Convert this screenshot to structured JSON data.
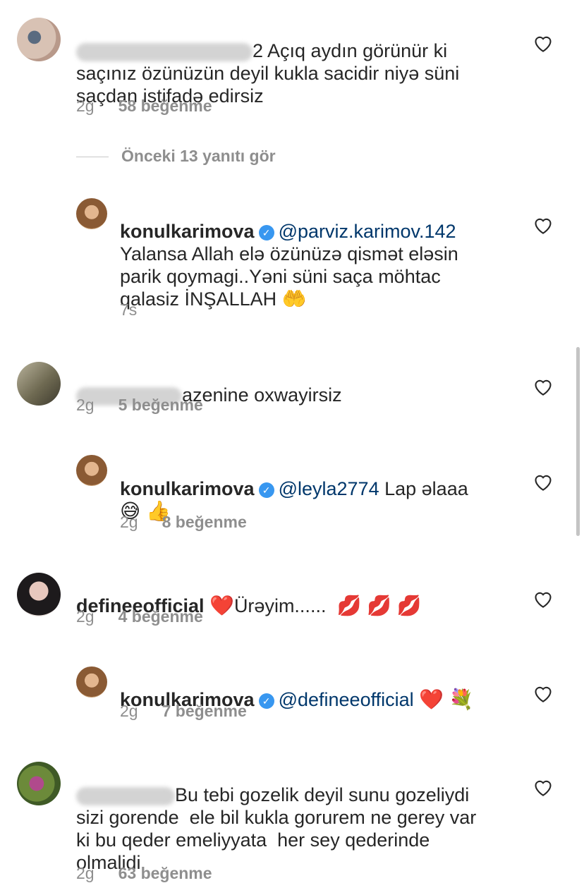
{
  "comments": [
    {
      "username_hidden": true,
      "text_suffix": "2 Açıq aydın görünür ki saçınız özünüzün deyil kukla sacidir niyə süni saçdan istifadə edirsiz",
      "line1": "2 Açıq aydın görünür ki",
      "line2": "saçınız özünüzün deyil kukla sacidir niyə süni",
      "line3": "saçdan istifadə edirsiz",
      "time": "2g",
      "likes": "58 beğenme",
      "view_replies": "Önceki 13 yanıtı gör",
      "reply": {
        "username": "konulkarimova",
        "mention": "@parviz.karimov.142",
        "line1": "Yalansa Allah elə özünüzə qismət eləsin",
        "line2": "parik qoymagi..Yəni süni saça möhtac",
        "line3": "qalasiz İNŞALLAH",
        "emoji": "🤲",
        "time": "7s"
      }
    },
    {
      "username_hidden": true,
      "text_suffix": "azenine oxwayirsiz",
      "time": "2g",
      "likes": "5 beğenme",
      "reply": {
        "username": "konulkarimova",
        "mention": "@leyla2774",
        "text": "Lap əlaaa",
        "emoji": "😅 👍",
        "time": "2g",
        "likes": "8 beğenme"
      }
    },
    {
      "username": "defineeofficial",
      "emoji_prefix": "❤️",
      "text": "Ürəyim......",
      "emoji_suffix": "💋 💋 💋",
      "time": "2g",
      "likes": "4 beğenme",
      "reply": {
        "username": "konulkarimova",
        "mention": "@defineeofficial",
        "emoji": "❤️ 💐",
        "time": "2g",
        "likes": "7 beğenme"
      }
    },
    {
      "username_hidden": true,
      "line1_suffix": "Bu tebi gozelik deyil sunu gozeliydi",
      "line2": "sizi gorende  ele bil kukla gorurem ne gerey var",
      "line3": "ki bu qeder emeliyyata  her sey qederinde",
      "line4": "olmalidi",
      "time": "2g",
      "likes": "63 beğenme"
    }
  ],
  "icons": {
    "like": "heart-outline-icon",
    "verified": "verified-badge-icon"
  },
  "colors": {
    "text": "#262626",
    "secondary": "#8e8e8e",
    "mention": "#00376b",
    "verified": "#3897f0"
  }
}
